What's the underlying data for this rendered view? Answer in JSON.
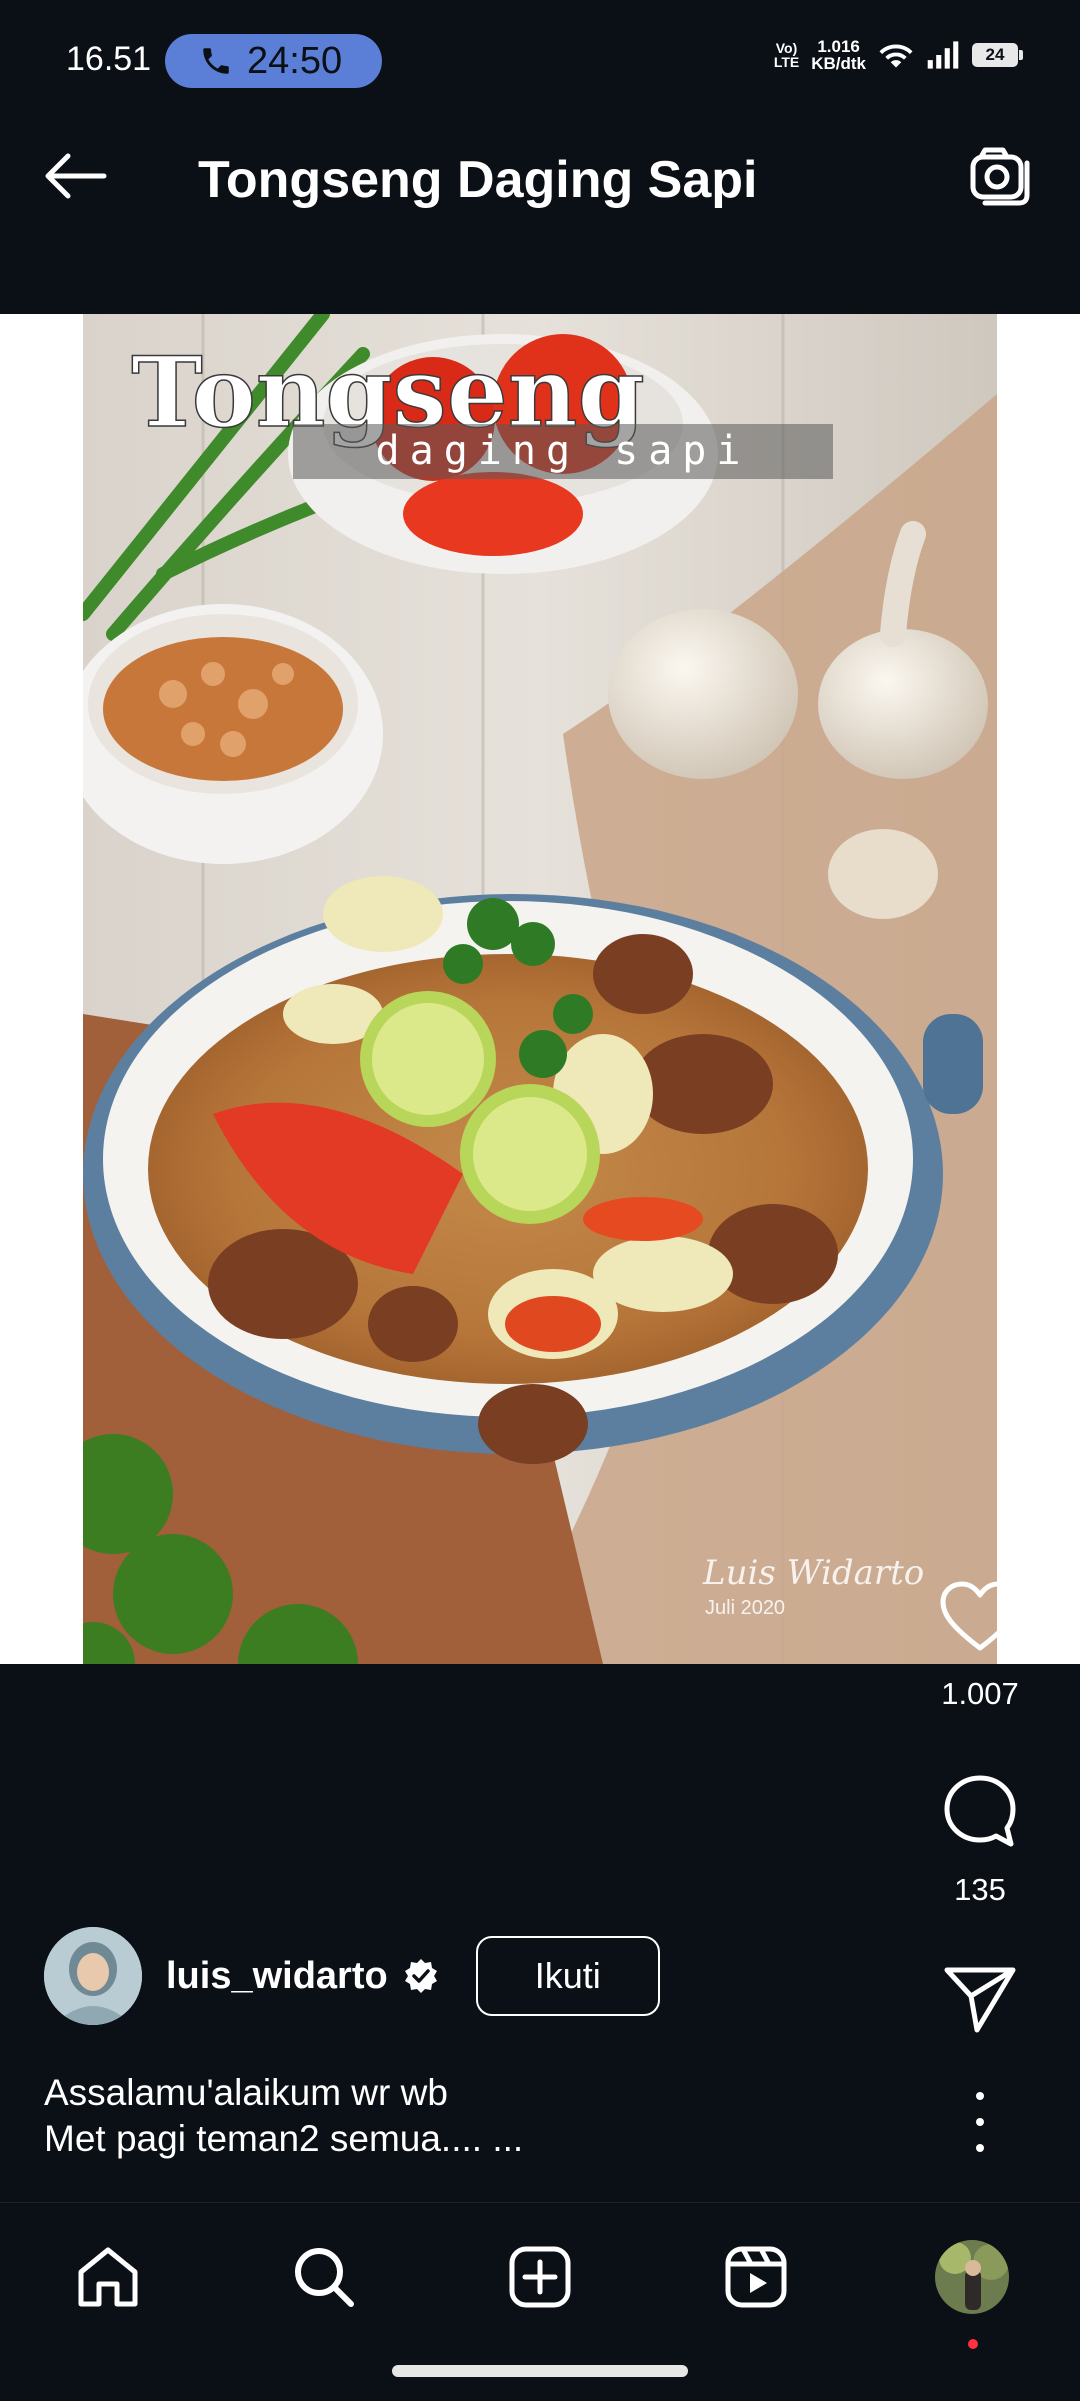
{
  "status_bar": {
    "time": "16.51",
    "call_timer": "24:50",
    "volte": "Vo) LTE",
    "net_speed_value": "1.016",
    "net_speed_unit": "KB/dtk",
    "battery": "24"
  },
  "header": {
    "title": "Tongseng Daging Sapi",
    "back_icon": "arrow-left-icon",
    "camera_icon": "camera-icon"
  },
  "media": {
    "overlay_title": "Tongseng",
    "overlay_subtitle": "daging sapi",
    "watermark_name": "Luis Widarto",
    "watermark_date": "Juli 2020"
  },
  "actions": {
    "likes": "1.007",
    "comments": "135",
    "like_icon": "heart-icon",
    "comment_icon": "comment-icon",
    "share_icon": "send-icon",
    "more_icon": "more-vertical-icon"
  },
  "author": {
    "username": "luis_widarto",
    "follow_label": "Ikuti"
  },
  "caption": {
    "line1": "Assalamu'alaikum wr wb",
    "line2": "Met pagi teman2 semua.... ..."
  },
  "bottom_nav": {
    "items": [
      "home-icon",
      "search-icon",
      "create-icon",
      "reels-icon",
      "profile-avatar"
    ]
  },
  "colors": {
    "background": "#0b0f16",
    "call_pill": "#5b7fd6",
    "notification_dot": "#ff3040"
  }
}
